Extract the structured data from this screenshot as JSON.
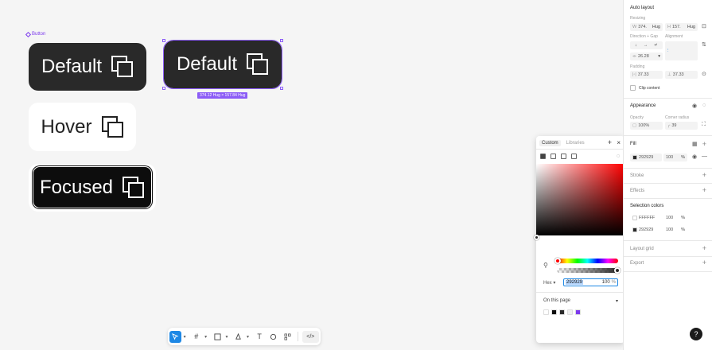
{
  "canvas": {
    "frame_label": "Button",
    "buttons": {
      "default_label": "Default",
      "selected_label": "Default",
      "hover_label": "Hover",
      "focused_label": "Focused"
    },
    "size_tag": "374.12 Hug × 157.84 Hug"
  },
  "toolbar": {
    "dev_mode_label": "</>"
  },
  "picker": {
    "tabs": [
      "Custom",
      "Libraries"
    ],
    "close": "×",
    "add": "+",
    "format": "Hex",
    "hex": "292929",
    "opacity": "100",
    "pct": "%",
    "page_select": "On this page",
    "swatches": [
      "#ffffff",
      "#0d0d0d",
      "#292929",
      "#f0f0f0",
      "#7c3aed"
    ]
  },
  "panel": {
    "auto_layout": {
      "title": "Auto layout",
      "resizing_label": "Resizing",
      "width_key": "W",
      "width_val": "374.",
      "width_mode": "Hug",
      "height_key": "H",
      "height_val": "157.",
      "height_mode": "Hug",
      "direction_label": "Direction + Gap",
      "alignment_label": "Alignment",
      "gap_val": "26.28",
      "padding_label": "Padding",
      "pad_h": "37.33",
      "pad_v": "37.33",
      "clip_label": "Clip content"
    },
    "appearance": {
      "title": "Appearance",
      "opacity_label": "Opacity",
      "opacity_val": "100%",
      "radius_label": "Corner radius",
      "radius_val": "39"
    },
    "fill": {
      "title": "Fill",
      "hex": "292929",
      "opacity": "100",
      "pct": "%",
      "swatch": "#292929"
    },
    "stroke": "Stroke",
    "effects": "Effects",
    "selection_colors": {
      "title": "Selection colors",
      "rows": [
        {
          "hex": "FFFFFF",
          "opacity": "100",
          "pct": "%",
          "swatch": "#ffffff"
        },
        {
          "hex": "292929",
          "opacity": "100",
          "pct": "%",
          "swatch": "#292929"
        }
      ]
    },
    "layout_grid": "Layout grid",
    "export": "Export",
    "help": "?"
  }
}
